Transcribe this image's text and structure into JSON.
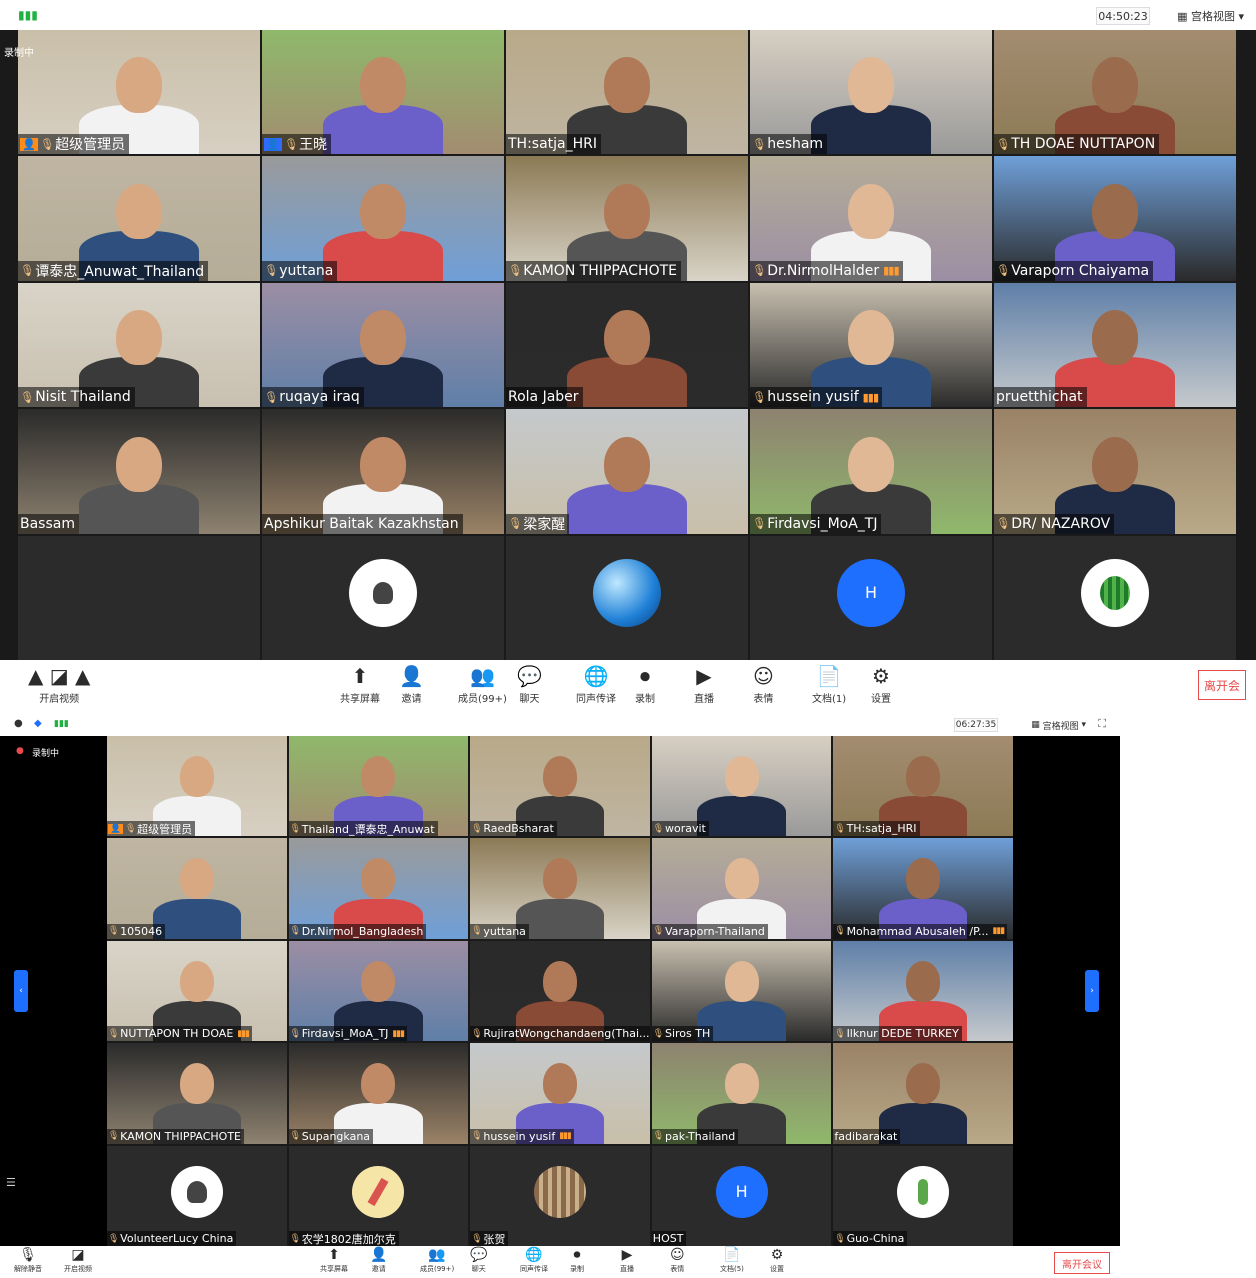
{
  "screen1": {
    "time": "04:50:23",
    "gallery_label": "宫格视图",
    "recording": "录制中",
    "video_label": "开启视频",
    "leave": "离开会",
    "toolbar": [
      {
        "label": "共享屏幕",
        "icon": "share-screen-icon"
      },
      {
        "label": "邀请",
        "icon": "invite-icon"
      },
      {
        "label": "成员(99+)",
        "icon": "members-icon"
      },
      {
        "label": "聊天",
        "icon": "chat-icon"
      },
      {
        "label": "同声传译",
        "icon": "interpretation-icon"
      },
      {
        "label": "录制",
        "icon": "record-icon"
      },
      {
        "label": "直播",
        "icon": "live-icon"
      },
      {
        "label": "表情",
        "icon": "emoji-icon"
      },
      {
        "label": "文档(1)",
        "icon": "document-icon"
      },
      {
        "label": "设置",
        "icon": "gear-icon"
      }
    ],
    "tiles": [
      {
        "name": "超级管理员",
        "mic": true,
        "host": true
      },
      {
        "name": "王晓",
        "mic": true,
        "cohost": true
      },
      {
        "name": "TH:satja_HRI",
        "mic": false
      },
      {
        "name": "hesham",
        "mic": true
      },
      {
        "name": "TH DOAE NUTTAPON",
        "mic": true
      },
      {
        "name": "谭泰忠_Anuwat_Thailand",
        "mic": true
      },
      {
        "name": "yuttana",
        "mic": true
      },
      {
        "name": "KAMON  THIPPACHOTE",
        "mic": true
      },
      {
        "name": "Dr.NirmolHalder",
        "mic": true,
        "signal": true
      },
      {
        "name": "Varaporn Chaiyama",
        "mic": true
      },
      {
        "name": "Nisit Thailand",
        "mic": true
      },
      {
        "name": "ruqaya iraq",
        "mic": true
      },
      {
        "name": "Rola Jaber",
        "mic": false
      },
      {
        "name": "hussein yusif",
        "mic": true,
        "signal": true
      },
      {
        "name": "pruetthichat",
        "mic": false
      },
      {
        "name": "Bassam",
        "mic": false
      },
      {
        "name": "Apshikur Baitak Kazakhstan",
        "mic": false
      },
      {
        "name": "梁家醒",
        "mic": true
      },
      {
        "name": "Firdavsi_MoA_TJ",
        "mic": true
      },
      {
        "name": "DR/ NAZAROV",
        "mic": true
      },
      {
        "name": "",
        "avatar": "none"
      },
      {
        "name": "",
        "avatar": "duang"
      },
      {
        "name": "",
        "avatar": "globe"
      },
      {
        "name": "",
        "avatar": "letter",
        "letter": "H"
      },
      {
        "name": "",
        "avatar": "watermelon"
      }
    ]
  },
  "screen2": {
    "time": "06:27:35",
    "gallery_label": "宫格视图",
    "recording": "录制中",
    "leave": "离开会议",
    "toolbar": [
      {
        "label": "共享屏幕",
        "icon": "share-screen-icon"
      },
      {
        "label": "邀请",
        "icon": "invite-icon"
      },
      {
        "label": "成员(99+)",
        "icon": "members-icon"
      },
      {
        "label": "聊天",
        "icon": "chat-icon"
      },
      {
        "label": "同声传译",
        "icon": "interpretation-icon"
      },
      {
        "label": "录制",
        "icon": "record-icon"
      },
      {
        "label": "直播",
        "icon": "live-icon"
      },
      {
        "label": "表情",
        "icon": "emoji-icon"
      },
      {
        "label": "文档(5)",
        "icon": "document-icon"
      },
      {
        "label": "设置",
        "icon": "gear-icon"
      }
    ],
    "left_items": [
      "解除静音",
      "开启视频"
    ],
    "tiles": [
      {
        "name": "超级管理员",
        "mic": true,
        "host": true
      },
      {
        "name": "Thailand_谭泰忠_Anuwat",
        "mic": true
      },
      {
        "name": "RaedBsharat",
        "mic": true
      },
      {
        "name": "woravit",
        "mic": true
      },
      {
        "name": "TH:satja_HRI",
        "mic": true
      },
      {
        "name": "105046",
        "mic": true
      },
      {
        "name": "Dr.Nirmol_Bangladesh",
        "mic": true
      },
      {
        "name": "yuttana",
        "mic": true
      },
      {
        "name": "Varaporn-Thailand",
        "mic": true
      },
      {
        "name": "Mohammad Abusaleh /P...",
        "mic": true,
        "signal": true
      },
      {
        "name": "NUTTAPON TH DOAE",
        "mic": true,
        "signal": true
      },
      {
        "name": "Firdavsi_MoA_TJ",
        "mic": true,
        "signal": true
      },
      {
        "name": "RujiratWongchandaeng(Thai...",
        "mic": true
      },
      {
        "name": "Siros TH",
        "mic": true
      },
      {
        "name": "Ilknur DEDE TURKEY",
        "mic": true
      },
      {
        "name": "KAMON  THIPPACHOTE",
        "mic": true
      },
      {
        "name": "Supangkana",
        "mic": true
      },
      {
        "name": "hussein yusif",
        "mic": true,
        "signal": true
      },
      {
        "name": "pak-Thailand",
        "mic": true
      },
      {
        "name": "fadibarakat",
        "mic": false
      },
      {
        "name": "VolunteerLucy China",
        "mic": true,
        "avatar": "duang"
      },
      {
        "name": "农学1802唐加尔克",
        "mic": true,
        "avatar": "kungfu"
      },
      {
        "name": "张贺",
        "mic": true,
        "avatar": "library"
      },
      {
        "name": "HOST",
        "mic": false,
        "avatar": "letter",
        "letter": "H"
      },
      {
        "name": "Guo-China",
        "mic": true,
        "avatar": "cactus"
      }
    ]
  }
}
